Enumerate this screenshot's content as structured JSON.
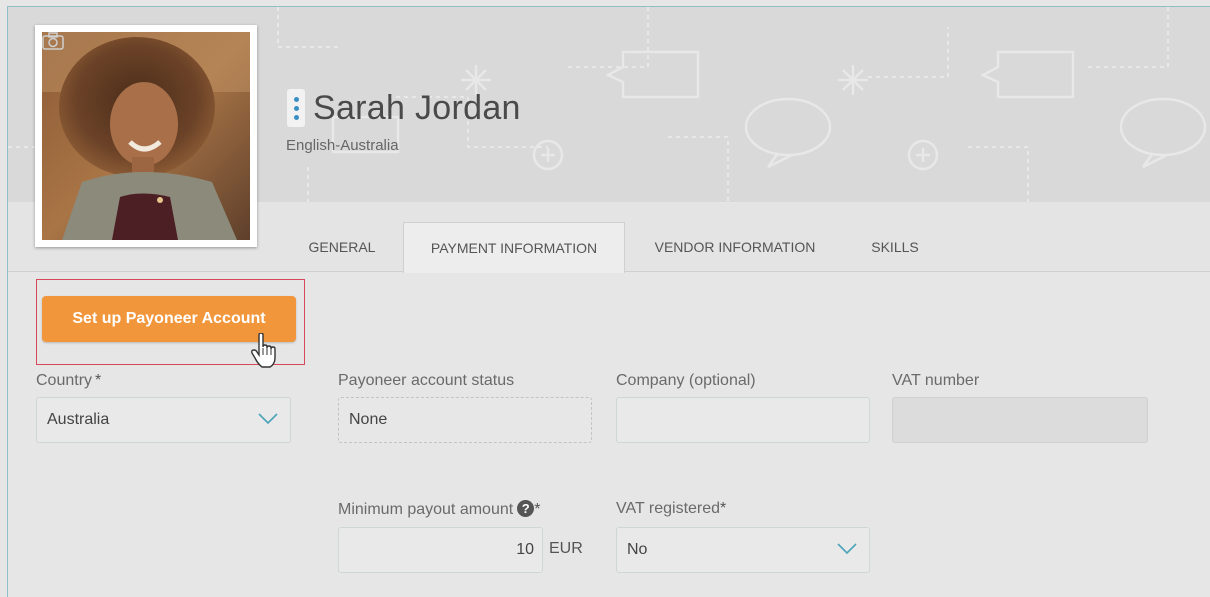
{
  "profile": {
    "name": "Sarah Jordan",
    "language": "English-Australia"
  },
  "tabs": [
    {
      "label": "GENERAL",
      "active": false
    },
    {
      "label": "PAYMENT INFORMATION",
      "active": true
    },
    {
      "label": "VENDOR INFORMATION",
      "active": false
    },
    {
      "label": "SKILLS",
      "active": false
    }
  ],
  "payoneer_button": {
    "label": "Set up Payoneer Account"
  },
  "form": {
    "country": {
      "label": "Country",
      "required_mark": "*",
      "value": "Australia"
    },
    "payoneer_status": {
      "label": "Payoneer account status",
      "value": "None"
    },
    "company": {
      "label": "Company (optional)",
      "value": ""
    },
    "vat_number": {
      "label": "VAT number",
      "value": ""
    },
    "min_payout": {
      "label": "Minimum payout amount",
      "help_icon": "?",
      "required_mark": "*",
      "value": "10",
      "currency": "EUR"
    },
    "vat_registered": {
      "label": "VAT registered",
      "required_mark": "*",
      "value": "No"
    }
  },
  "colors": {
    "accent_orange": "#f2963b",
    "highlight_red": "#d8475a",
    "kebab_blue": "#3b8dc6"
  },
  "icons": [
    "kebab-menu-icon",
    "camera-icon",
    "chevron-down-icon",
    "question-circle-icon",
    "hand-pointer-cursor-icon"
  ]
}
